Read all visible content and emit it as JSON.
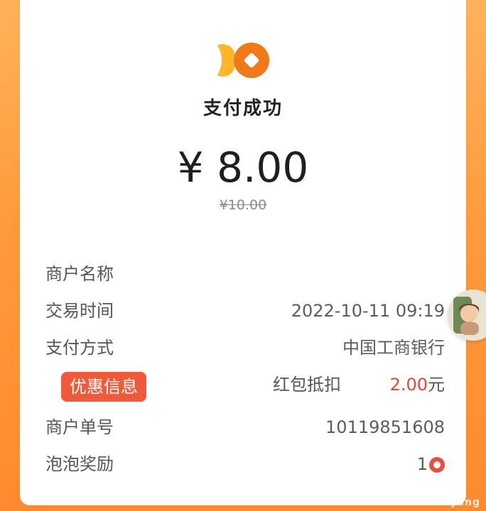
{
  "receipt": {
    "status": "支付成功",
    "amount": "¥ 8.00",
    "original_amount": "¥10.00"
  },
  "details": [
    {
      "label": "商户名称",
      "value": ""
    },
    {
      "label": "交易时间",
      "value": "2022-10-11 09:19"
    },
    {
      "label": "支付方式",
      "value": "中国工商银行"
    },
    {
      "label": "优惠信息",
      "desc": "红包抵扣",
      "value_num": "2.00",
      "value_unit": "元"
    },
    {
      "label": "商户单号",
      "value": "10119851608"
    },
    {
      "label": "泡泡奖励",
      "value": "1"
    }
  ],
  "colors": {
    "brand_orange": "#ff8a2f",
    "promo_red": "#f05a3a",
    "amount_red": "#e4473b"
  },
  "watermark": "cardyang"
}
